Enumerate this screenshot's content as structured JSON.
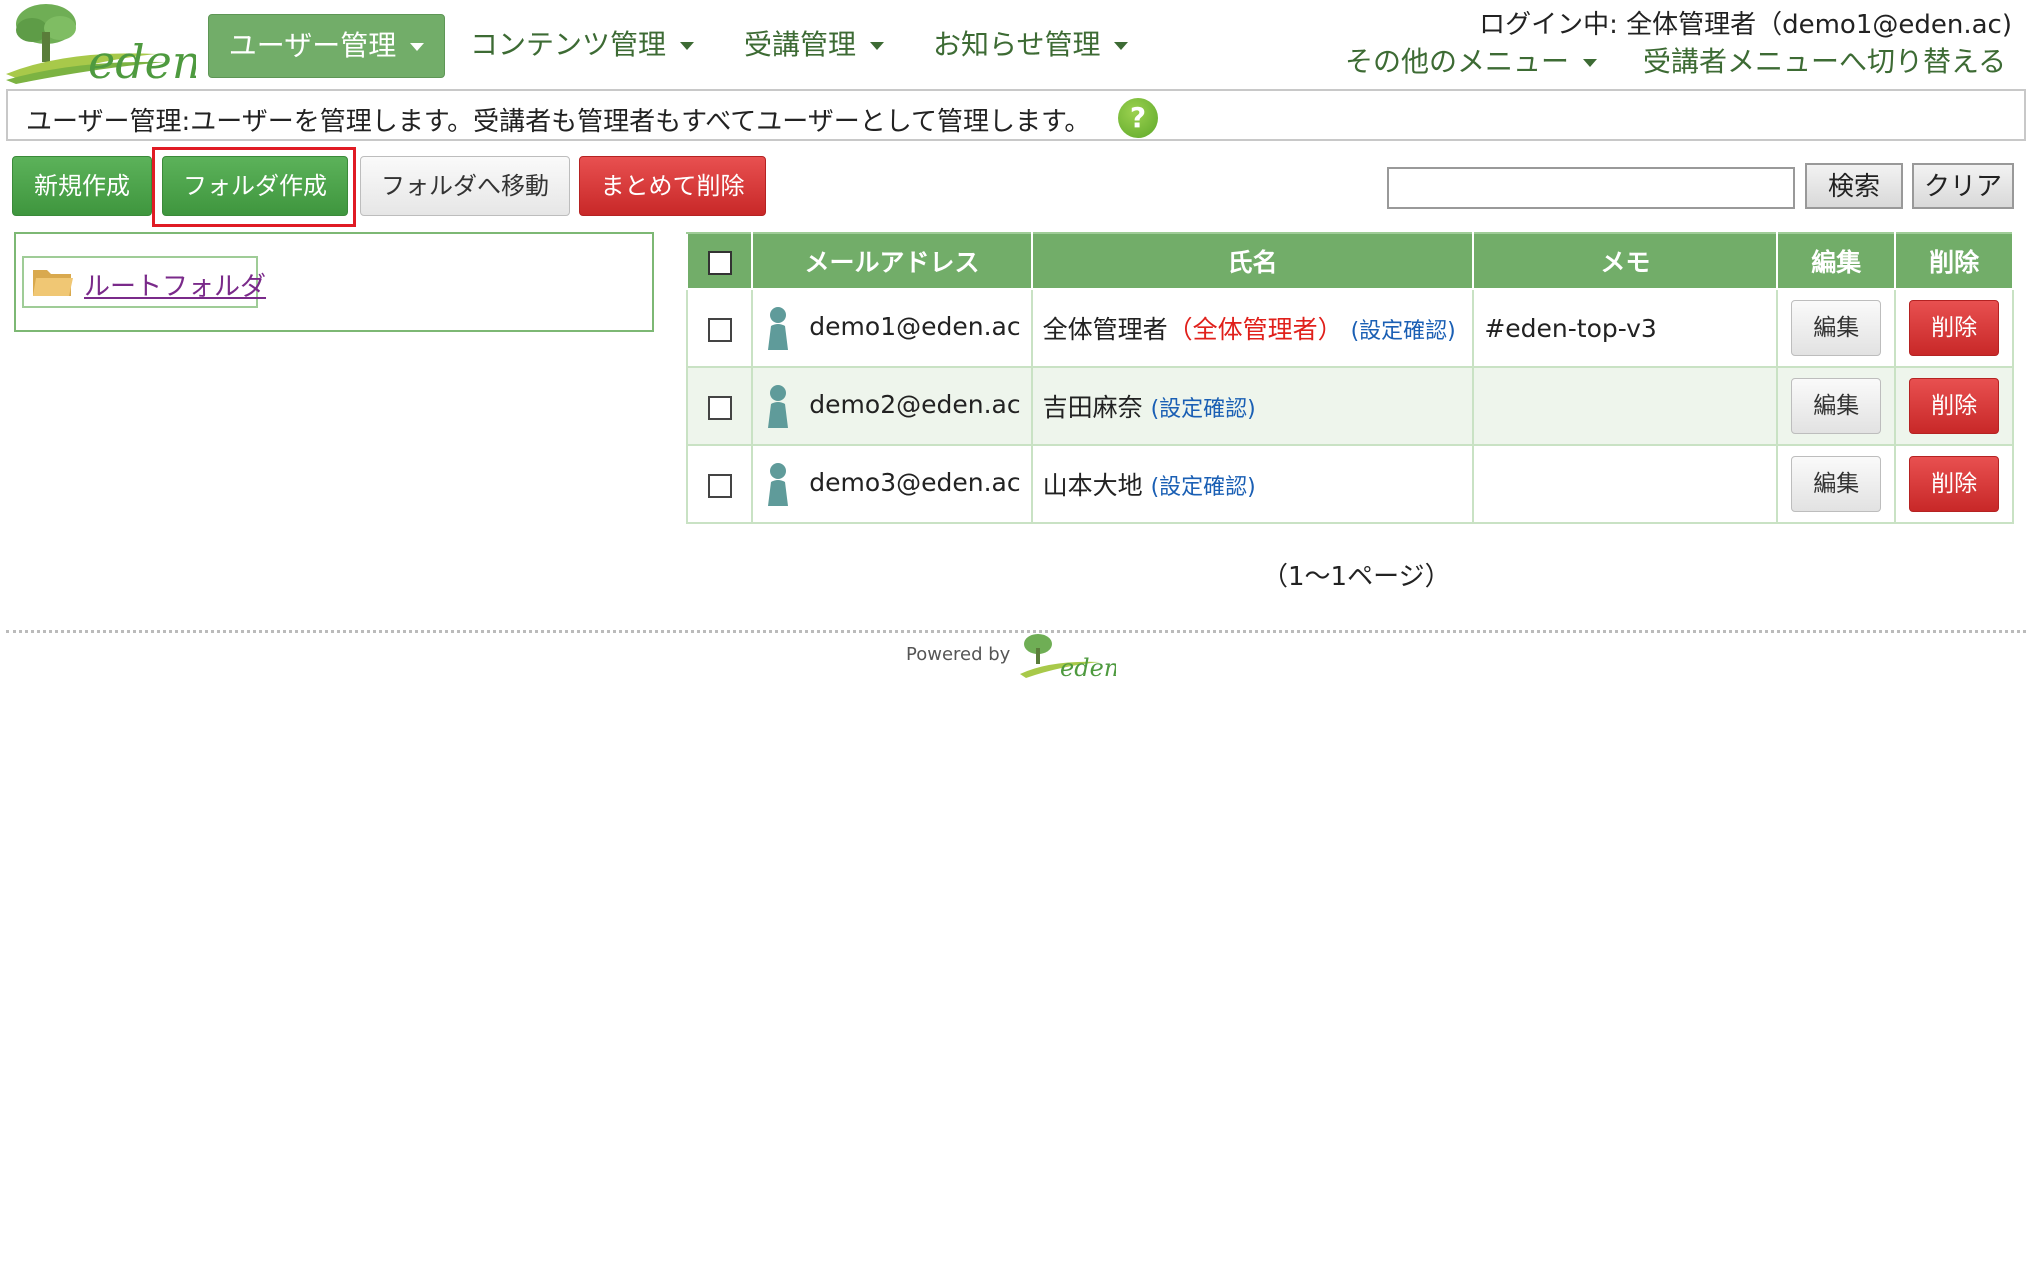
{
  "header": {
    "nav": [
      {
        "label": "ユーザー管理"
      },
      {
        "label": "コンテンツ管理"
      },
      {
        "label": "受講管理"
      },
      {
        "label": "お知らせ管理"
      }
    ],
    "login_info": "ログイン中: 全体管理者（demo1@eden.ac)",
    "other_menu": "その他のメニュー",
    "switch_menu": "受講者メニューへ切り替える",
    "logo_text": "eden"
  },
  "description": "ユーザー管理:ユーザーを管理します。受講者も管理者もすべてユーザーとして管理します。",
  "help_icon": "?",
  "toolbar": {
    "new_label": "新規作成",
    "folder_label": "フォルダ作成",
    "move_label": "フォルダへ移動",
    "bulk_delete_label": "まとめて削除",
    "search_value": "",
    "search_label": "検索",
    "clear_label": "クリア"
  },
  "folder_tree": {
    "root_label": "ルートフォルダ"
  },
  "table": {
    "headers": {
      "email": "メールアドレス",
      "name": "氏名",
      "memo": "メモ",
      "edit": "編集",
      "delete": "削除"
    },
    "rows": [
      {
        "email": "demo1@eden.ac",
        "name": "全体管理者",
        "role": "（全体管理者）",
        "confirm": "(設定確認)",
        "memo": "#eden-top-v3",
        "edit": "編集",
        "delete": "削除"
      },
      {
        "email": "demo2@eden.ac",
        "name": "吉田麻奈",
        "role": "",
        "confirm": "(設定確認)",
        "memo": "",
        "edit": "編集",
        "delete": "削除"
      },
      {
        "email": "demo3@eden.ac",
        "name": "山本大地",
        "role": "",
        "confirm": "(設定確認)",
        "memo": "",
        "edit": "編集",
        "delete": "削除"
      }
    ]
  },
  "pagination": "（1～1ページ）",
  "footer": {
    "powered_by": "Powered by",
    "logo_text": "eden"
  },
  "colors": {
    "brand_green": "#72ad69",
    "danger_red": "#c82828",
    "link_blue": "#1a5fb4",
    "highlight": "#e01b24"
  }
}
